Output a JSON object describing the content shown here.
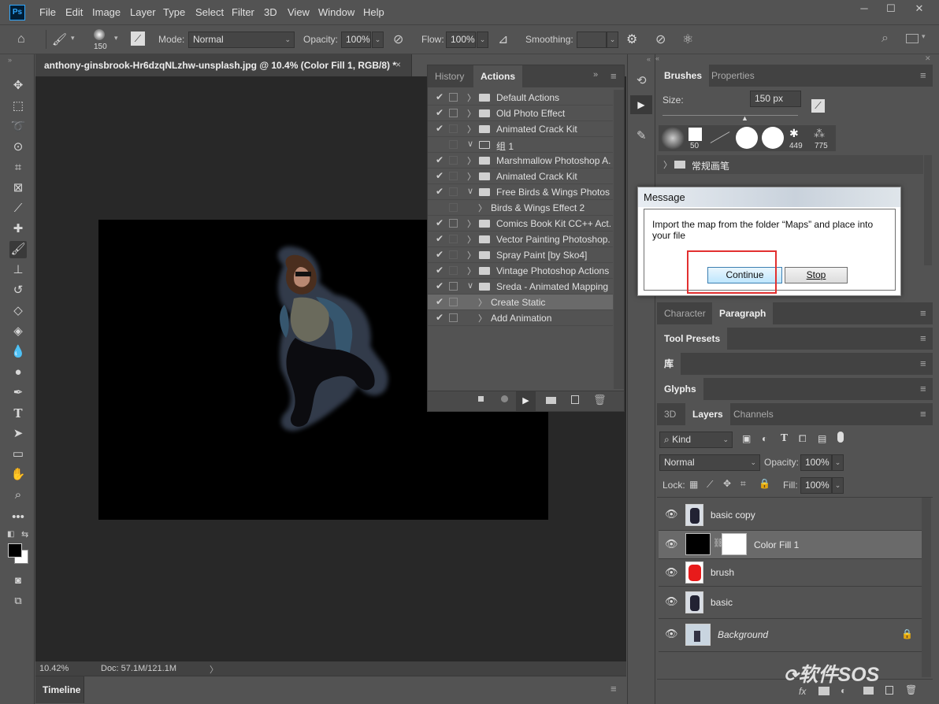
{
  "menubar": {
    "logo": "Ps",
    "items": [
      "File",
      "Edit",
      "Image",
      "Layer",
      "Type",
      "Select",
      "Filter",
      "3D",
      "View",
      "Window",
      "Help"
    ]
  },
  "options": {
    "brush_size": "150",
    "mode_label": "Mode:",
    "mode_value": "Normal",
    "opacity_label": "Opacity:",
    "opacity_value": "100%",
    "flow_label": "Flow:",
    "flow_value": "100%",
    "smoothing_label": "Smoothing:",
    "smoothing_value": ""
  },
  "document": {
    "tab_title": "anthony-ginsbrook-Hr6dzqNLzhw-unsplash.jpg @ 10.4% (Color Fill 1, RGB/8) *",
    "zoom": "10.42%",
    "doc_size": "Doc: 57.1M/121.1M"
  },
  "timeline": {
    "label": "Timeline"
  },
  "actions_panel": {
    "tabs": [
      "History",
      "Actions"
    ],
    "rows": [
      {
        "check": "✔",
        "dialog": true,
        "twisty": "〉",
        "folder": "closed",
        "label": "Default Actions",
        "indent": 0
      },
      {
        "check": "✔",
        "dialog": true,
        "twisty": "〉",
        "folder": "closed",
        "label": "Old Photo Effect",
        "indent": 0
      },
      {
        "check": "✔",
        "dialog": false,
        "twisty": "〉",
        "folder": "closed",
        "label": "Animated Crack Kit",
        "indent": 0
      },
      {
        "check": "",
        "dialog": false,
        "twisty": "∨",
        "folder": "open",
        "label": "组 1",
        "indent": 0
      },
      {
        "check": "✔",
        "dialog": false,
        "twisty": "〉",
        "folder": "closed",
        "label": "Marshmallow Photoshop A...",
        "indent": 0
      },
      {
        "check": "✔",
        "dialog": false,
        "twisty": "〉",
        "folder": "closed",
        "label": "Animated Crack Kit",
        "indent": 0
      },
      {
        "check": "✔",
        "dialog": false,
        "twisty": "∨",
        "folder": "closed",
        "label": "Free Birds & Wings Photos...",
        "indent": 0
      },
      {
        "check": "",
        "dialog": false,
        "twisty": "〉",
        "folder": "none",
        "label": "Birds & Wings Effect 2",
        "indent": 1
      },
      {
        "check": "✔",
        "dialog": true,
        "twisty": "〉",
        "folder": "closed",
        "label": "Comics Book Kit CC++ Act...",
        "indent": 0
      },
      {
        "check": "✔",
        "dialog": false,
        "twisty": "〉",
        "folder": "closed",
        "label": "Vector Painting Photoshop...",
        "indent": 0
      },
      {
        "check": "✔",
        "dialog": false,
        "twisty": "〉",
        "folder": "closed",
        "label": "Spray Paint [by Sko4]",
        "indent": 0
      },
      {
        "check": "✔",
        "dialog": false,
        "twisty": "〉",
        "folder": "closed",
        "label": "Vintage Photoshop Actions",
        "indent": 0
      },
      {
        "check": "✔",
        "dialog": true,
        "twisty": "∨",
        "folder": "closed",
        "label": "Sreda - Animated Mapping",
        "indent": 0
      },
      {
        "check": "✔",
        "dialog": true,
        "twisty": "〉",
        "folder": "none",
        "label": "Create Static",
        "indent": 1,
        "selected": true
      },
      {
        "check": "✔",
        "dialog": true,
        "twisty": "〉",
        "folder": "none",
        "label": "Add Animation",
        "indent": 1
      }
    ]
  },
  "brushes_panel": {
    "tabs": [
      "Brushes",
      "Properties"
    ],
    "size_label": "Size:",
    "size_value": "150 px",
    "preset_sizes": [
      "50",
      "449",
      "775"
    ],
    "folders": [
      "常规画笔"
    ]
  },
  "collapsed_panels": {
    "character": "Character",
    "paragraph": "Paragraph",
    "tool_presets": "Tool Presets",
    "library": "库",
    "glyphs": "Glyphs"
  },
  "layers_panel": {
    "tabs": [
      "3D",
      "Layers",
      "Channels"
    ],
    "filter_kind": "Kind",
    "blend_mode": "Normal",
    "opacity_label": "Opacity:",
    "opacity_value": "100%",
    "lock_label": "Lock:",
    "fill_label": "Fill:",
    "fill_value": "100%",
    "layers": [
      {
        "name": "basic copy"
      },
      {
        "name": "Color Fill 1"
      },
      {
        "name": "brush"
      },
      {
        "name": "basic"
      },
      {
        "name": "Background"
      }
    ]
  },
  "dialog": {
    "title": "Message",
    "message": "Import the map from the folder “Maps” and place into your file",
    "continue_label": "Continue",
    "stop_label": "Stop"
  },
  "watermark": {
    "text": "软件SOS"
  }
}
